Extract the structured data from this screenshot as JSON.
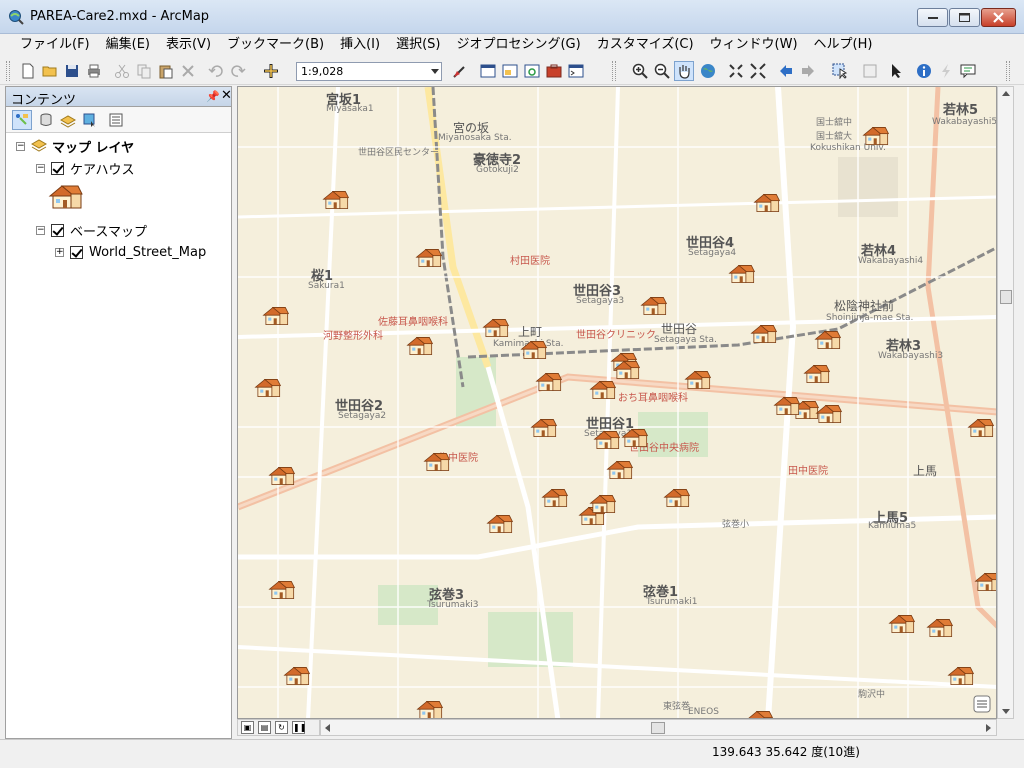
{
  "window": {
    "title": "PAREA-Care2.mxd - ArcMap"
  },
  "menu": [
    "ファイル(F)",
    "編集(E)",
    "表示(V)",
    "ブックマーク(B)",
    "挿入(I)",
    "選択(S)",
    "ジオプロセシング(G)",
    "カスタマイズ(C)",
    "ウィンドウ(W)",
    "ヘルプ(H)"
  ],
  "toolbar": {
    "scale": "1:9,028"
  },
  "contents": {
    "title": "コンテンツ",
    "pin": "ᵖ",
    "close": "✕",
    "root": "マップ レイヤ",
    "layers": [
      {
        "name": "ケアハウス"
      },
      {
        "name": "ベースマップ"
      },
      {
        "name": "World_Street_Map"
      }
    ]
  },
  "map": {
    "labels": [
      {
        "text": "宮坂1",
        "cls": "big"
      },
      {
        "text": "Miyasaka1",
        "cls": "small"
      },
      {
        "text": "宮の坂",
        "cls": ""
      },
      {
        "text": "Miyanosaka Sta.",
        "cls": "small"
      },
      {
        "text": "豪徳寺2",
        "cls": "big"
      },
      {
        "text": "Gotokuji2",
        "cls": "small"
      },
      {
        "text": "世田谷4",
        "cls": "big"
      },
      {
        "text": "Setagaya4",
        "cls": "small"
      },
      {
        "text": "若林5",
        "cls": "big"
      },
      {
        "text": "Wakabayashi5",
        "cls": "small"
      },
      {
        "text": "若林4",
        "cls": "big"
      },
      {
        "text": "Wakabayashi4",
        "cls": "small"
      },
      {
        "text": "桜1",
        "cls": "big"
      },
      {
        "text": "Sakura1",
        "cls": "small"
      },
      {
        "text": "世田谷3",
        "cls": "big"
      },
      {
        "text": "Setagaya3",
        "cls": "small"
      },
      {
        "text": "上町",
        "cls": ""
      },
      {
        "text": "Kamimachi Sta.",
        "cls": "small"
      },
      {
        "text": "世田谷",
        "cls": ""
      },
      {
        "text": "Setagaya Sta.",
        "cls": "small"
      },
      {
        "text": "松陰神社前",
        "cls": ""
      },
      {
        "text": "Shoinjinja-mae Sta.",
        "cls": "small"
      },
      {
        "text": "若林3",
        "cls": "big"
      },
      {
        "text": "Wakabayashi3",
        "cls": "small"
      },
      {
        "text": "世田谷2",
        "cls": "big"
      },
      {
        "text": "Setagaya2",
        "cls": "small"
      },
      {
        "text": "世田谷1",
        "cls": "big"
      },
      {
        "text": "Setagaya1",
        "cls": "small"
      },
      {
        "text": "上馬5",
        "cls": "big"
      },
      {
        "text": "Kamiuma5",
        "cls": "small"
      },
      {
        "text": "弦巻3",
        "cls": "big"
      },
      {
        "text": "Tsurumaki3",
        "cls": "small"
      },
      {
        "text": "弦巻1",
        "cls": "big"
      },
      {
        "text": "Tsurumaki1",
        "cls": "small"
      },
      {
        "text": "上馬",
        "cls": ""
      },
      {
        "text": "世田谷区民センター",
        "cls": "small"
      },
      {
        "text": "村田医院",
        "cls": "red"
      },
      {
        "text": "佐藤耳鼻咽喉科",
        "cls": "red"
      },
      {
        "text": "世田谷クリニック",
        "cls": "red"
      },
      {
        "text": "河野整形外科",
        "cls": "red"
      },
      {
        "text": "佐中医院",
        "cls": "red"
      },
      {
        "text": "おち耳鼻咽喉科",
        "cls": "red"
      },
      {
        "text": "世田谷中央病院",
        "cls": "red"
      },
      {
        "text": "田中医院",
        "cls": "red"
      },
      {
        "text": "弦巻小",
        "cls": "small"
      },
      {
        "text": "ENEOS",
        "cls": "small"
      },
      {
        "text": "駒沢中",
        "cls": "small"
      },
      {
        "text": "東弦巻",
        "cls": "small"
      },
      {
        "text": "国士舘中",
        "cls": "small"
      },
      {
        "text": "国士舘大",
        "cls": "small"
      },
      {
        "text": "Kokushikan Univ.",
        "cls": "small"
      }
    ]
  },
  "statusbar": {
    "coords": "139.643  35.642 度(10進)"
  }
}
